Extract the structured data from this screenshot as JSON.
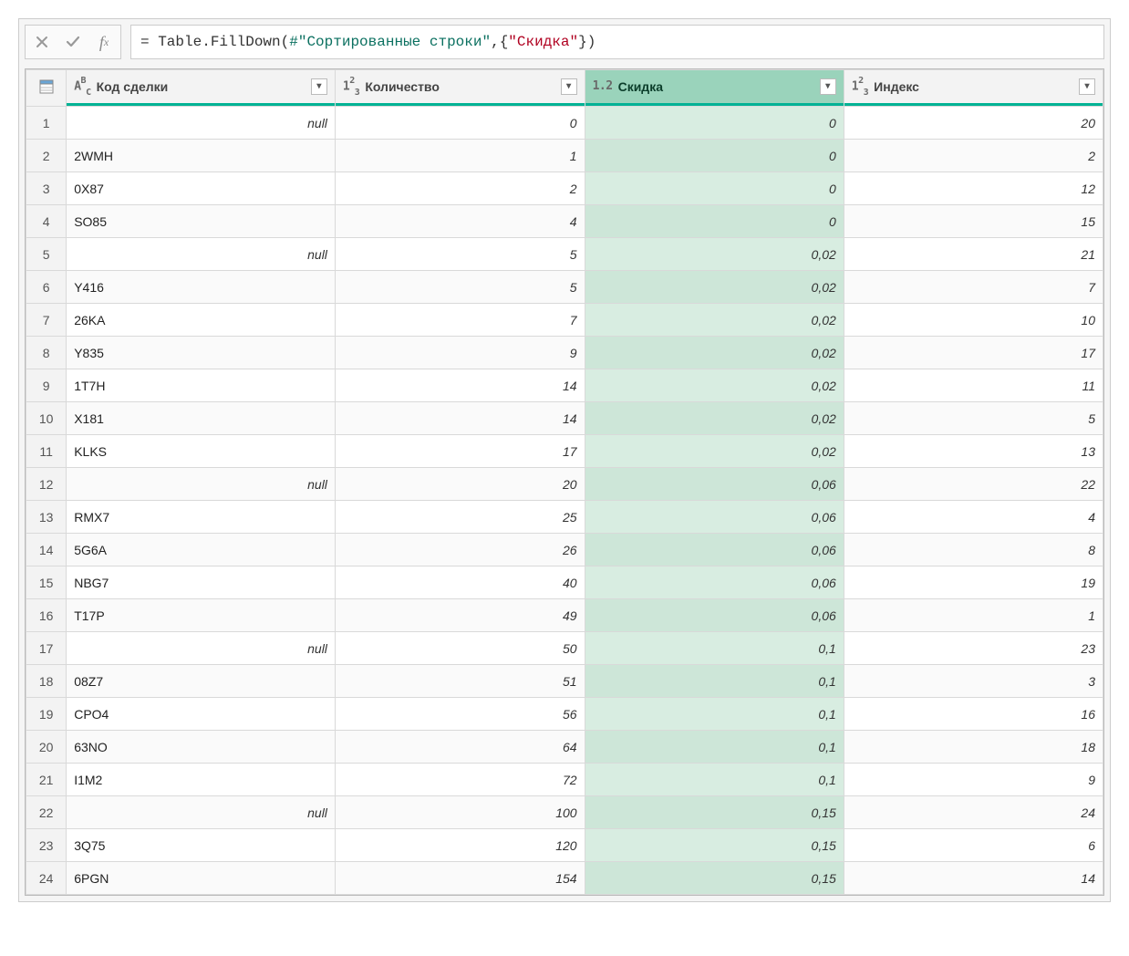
{
  "formula": {
    "prefix": "= ",
    "fn": "Table.FillDown",
    "open": "(",
    "varPrefix": "#",
    "varQuoted": "\"Сортированные строки\"",
    "comma": ",",
    "braceOpen": "{",
    "arg2": "\"Скидка\"",
    "braceClose": "}",
    "close": ")"
  },
  "columns": [
    {
      "name": "Код сделки",
      "typeLabel": "ABC",
      "kind": "text",
      "selected": false
    },
    {
      "name": "Количество",
      "typeLabel": "123",
      "kind": "int",
      "selected": false
    },
    {
      "name": "Скидка",
      "typeLabel": "1.2",
      "kind": "dec",
      "selected": true
    },
    {
      "name": "Индекс",
      "typeLabel": "123",
      "kind": "int",
      "selected": false
    }
  ],
  "rows": [
    {
      "n": 1,
      "code": null,
      "qty": "0",
      "disc": "0",
      "idx": "20"
    },
    {
      "n": 2,
      "code": "2WMH",
      "qty": "1",
      "disc": "0",
      "idx": "2"
    },
    {
      "n": 3,
      "code": "0X87",
      "qty": "2",
      "disc": "0",
      "idx": "12"
    },
    {
      "n": 4,
      "code": "SO85",
      "qty": "4",
      "disc": "0",
      "idx": "15"
    },
    {
      "n": 5,
      "code": null,
      "qty": "5",
      "disc": "0,02",
      "idx": "21"
    },
    {
      "n": 6,
      "code": "Y416",
      "qty": "5",
      "disc": "0,02",
      "idx": "7"
    },
    {
      "n": 7,
      "code": "26KA",
      "qty": "7",
      "disc": "0,02",
      "idx": "10"
    },
    {
      "n": 8,
      "code": "Y835",
      "qty": "9",
      "disc": "0,02",
      "idx": "17"
    },
    {
      "n": 9,
      "code": "1T7H",
      "qty": "14",
      "disc": "0,02",
      "idx": "11"
    },
    {
      "n": 10,
      "code": "X181",
      "qty": "14",
      "disc": "0,02",
      "idx": "5"
    },
    {
      "n": 11,
      "code": "KLKS",
      "qty": "17",
      "disc": "0,02",
      "idx": "13"
    },
    {
      "n": 12,
      "code": null,
      "qty": "20",
      "disc": "0,06",
      "idx": "22"
    },
    {
      "n": 13,
      "code": "RMX7",
      "qty": "25",
      "disc": "0,06",
      "idx": "4"
    },
    {
      "n": 14,
      "code": "5G6A",
      "qty": "26",
      "disc": "0,06",
      "idx": "8"
    },
    {
      "n": 15,
      "code": "NBG7",
      "qty": "40",
      "disc": "0,06",
      "idx": "19"
    },
    {
      "n": 16,
      "code": "T17P",
      "qty": "49",
      "disc": "0,06",
      "idx": "1"
    },
    {
      "n": 17,
      "code": null,
      "qty": "50",
      "disc": "0,1",
      "idx": "23"
    },
    {
      "n": 18,
      "code": "08Z7",
      "qty": "51",
      "disc": "0,1",
      "idx": "3"
    },
    {
      "n": 19,
      "code": "CPO4",
      "qty": "56",
      "disc": "0,1",
      "idx": "16"
    },
    {
      "n": 20,
      "code": "63NO",
      "qty": "64",
      "disc": "0,1",
      "idx": "18"
    },
    {
      "n": 21,
      "code": "I1M2",
      "qty": "72",
      "disc": "0,1",
      "idx": "9"
    },
    {
      "n": 22,
      "code": null,
      "qty": "100",
      "disc": "0,15",
      "idx": "24"
    },
    {
      "n": 23,
      "code": "3Q75",
      "qty": "120",
      "disc": "0,15",
      "idx": "6"
    },
    {
      "n": 24,
      "code": "6PGN",
      "qty": "154",
      "disc": "0,15",
      "idx": "14"
    }
  ],
  "nullLabel": "null"
}
